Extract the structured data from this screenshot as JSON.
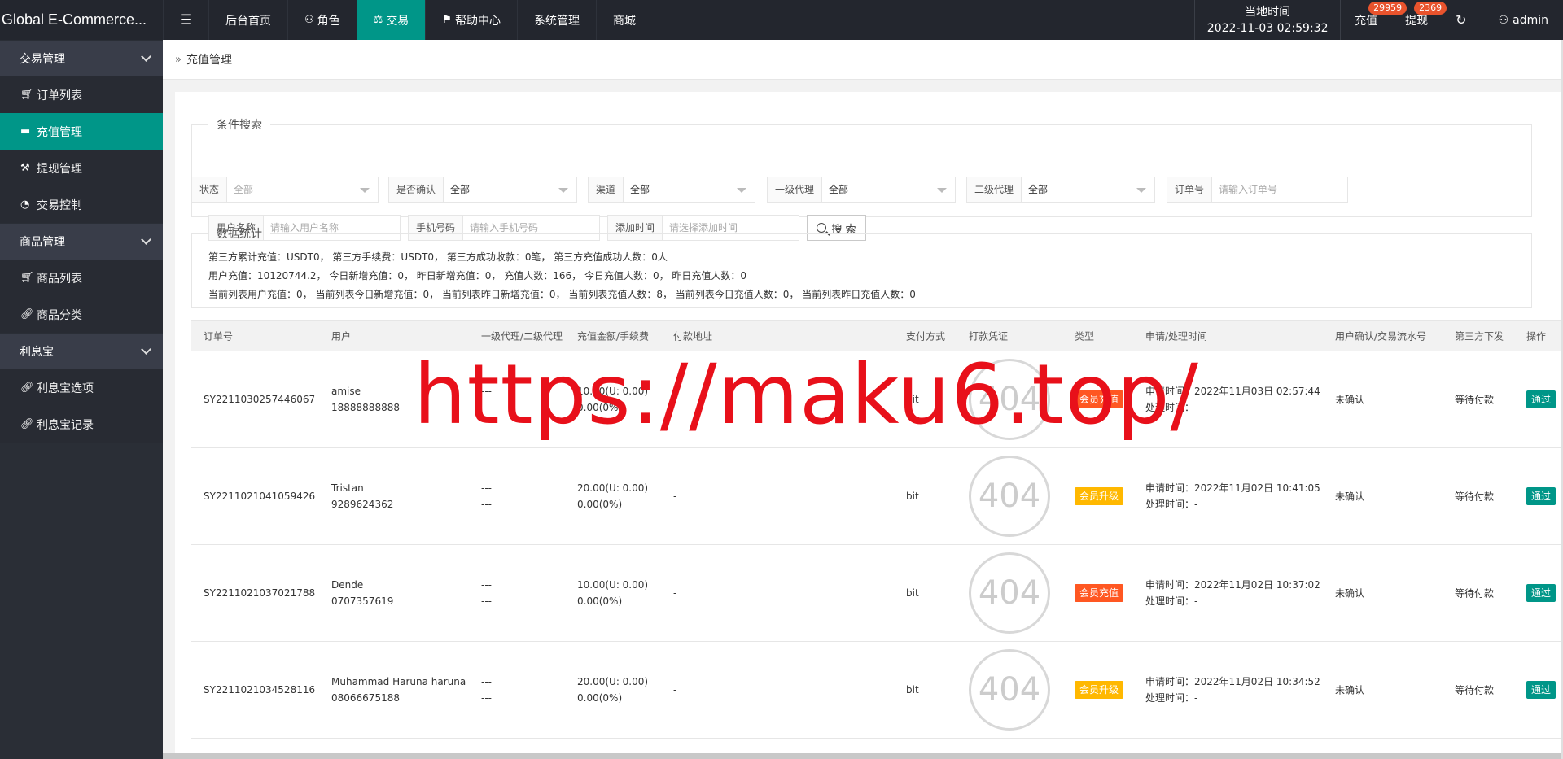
{
  "header": {
    "brand": "Global E-Commerce...",
    "menu_icon": "hamburger-icon",
    "nav": [
      {
        "label": "后台首页",
        "icon": ""
      },
      {
        "label": "角色",
        "icon": "user-icon"
      },
      {
        "label": "交易",
        "icon": "scale-icon"
      },
      {
        "label": "帮助中心",
        "icon": "flag-icon"
      },
      {
        "label": "系统管理",
        "icon": ""
      },
      {
        "label": "商城",
        "icon": ""
      }
    ],
    "clock_label": "当地时间",
    "clock_value": "2022-11-03 02:59:32",
    "recharge_label": "充值",
    "recharge_badge": "29959",
    "withdraw_label": "提现",
    "withdraw_badge": "2369",
    "user": "admin",
    "accent_color": "#009688"
  },
  "sidebar": {
    "groups": [
      {
        "label": "交易管理",
        "items": [
          {
            "label": "订单列表",
            "icon": "cart-icon"
          },
          {
            "label": "充值管理",
            "icon": "card-icon"
          },
          {
            "label": "提现管理",
            "icon": "gavel-icon"
          },
          {
            "label": "交易控制",
            "icon": "gauge-icon"
          }
        ]
      },
      {
        "label": "商品管理",
        "items": [
          {
            "label": "商品列表",
            "icon": "cart-icon"
          },
          {
            "label": "商品分类",
            "icon": "link-icon"
          }
        ]
      },
      {
        "label": "利息宝",
        "items": [
          {
            "label": "利息宝选项",
            "icon": "link-icon"
          },
          {
            "label": "利息宝记录",
            "icon": "link-icon"
          }
        ]
      }
    ]
  },
  "breadcrumb": "充值管理",
  "search": {
    "legend": "条件搜索",
    "status_label": "状态",
    "status_value": "全部",
    "confirm_label": "是否确认",
    "confirm_value": "全部",
    "channel_label": "渠道",
    "channel_value": "全部",
    "agent1_label": "一级代理",
    "agent1_value": "全部",
    "agent2_label": "二级代理",
    "agent2_value": "全部",
    "order_label": "订单号",
    "order_placeholder": "请输入订单号",
    "username_label": "用户名称",
    "username_placeholder": "请输入用户名称",
    "phone_label": "手机号码",
    "phone_placeholder": "请输入手机号码",
    "time_label": "添加时间",
    "time_placeholder": "请选择添加时间",
    "button": "搜 索"
  },
  "stats": {
    "legend": "数据统计",
    "line1": "第三方累计充值：USDT0，  第三方手续费：USDT0，  第三方成功收款：0笔，  第三方充值成功人数：0人",
    "line2": "用户充值：10120744.2，  今日新增充值：0，  昨日新增充值：0，  充值人数：166，  今日充值人数：0，  昨日充值人数：0",
    "line3": "当前列表用户充值：0，  当前列表今日新增充值：0，  当前列表昨日新增充值：0，  当前列表充值人数：8，  当前列表今日充值人数：0，  当前列表昨日充值人数：0"
  },
  "table": {
    "columns": [
      "订单号",
      "用户",
      "一级代理/二级代理",
      "充值金额/手续费",
      "付款地址",
      "支付方式",
      "打款凭证",
      "类型",
      "申请/处理时间",
      "用户确认/交易流水号",
      "第三方下发",
      "操作"
    ],
    "rows": [
      {
        "order": "SY2211030257446067",
        "user_name": "amise",
        "user_phone": "18888888888",
        "agent1": "---",
        "agent2": "---",
        "amount": "10.00(U: 0.00)",
        "fee": "0.00(0%)",
        "address": "-",
        "pay": "bit",
        "proof": "404",
        "type": "会员充值",
        "type_color": "#ff5722",
        "apply": "申请时间：2022年11月03日 02:57:44",
        "handle": "处理时间：-",
        "confirm": "未确认",
        "third": "等待付款",
        "action": "通过"
      },
      {
        "order": "SY2211021041059426",
        "user_name": "Tristan",
        "user_phone": "9289624362",
        "agent1": "---",
        "agent2": "---",
        "amount": "20.00(U: 0.00)",
        "fee": "0.00(0%)",
        "address": "-",
        "pay": "bit",
        "proof": "404",
        "type": "会员升级",
        "type_color": "#ffb800",
        "apply": "申请时间：2022年11月02日 10:41:05",
        "handle": "处理时间：-",
        "confirm": "未确认",
        "third": "等待付款",
        "action": "通过"
      },
      {
        "order": "SY2211021037021788",
        "user_name": "Dende",
        "user_phone": "0707357619",
        "agent1": "---",
        "agent2": "---",
        "amount": "10.00(U: 0.00)",
        "fee": "0.00(0%)",
        "address": "-",
        "pay": "bit",
        "proof": "404",
        "type": "会员充值",
        "type_color": "#ff5722",
        "apply": "申请时间：2022年11月02日 10:37:02",
        "handle": "处理时间：-",
        "confirm": "未确认",
        "third": "等待付款",
        "action": "通过"
      },
      {
        "order": "SY2211021034528116",
        "user_name": "Muhammad Haruna haruna",
        "user_phone": "08066675188",
        "agent1": "---",
        "agent2": "---",
        "amount": "20.00(U: 0.00)",
        "fee": "0.00(0%)",
        "address": "-",
        "pay": "bit",
        "proof": "404",
        "type": "会员升级",
        "type_color": "#ffb800",
        "apply": "申请时间：2022年11月02日 10:34:52",
        "handle": "处理时间：-",
        "confirm": "未确认",
        "third": "等待付款",
        "action": "通过"
      }
    ]
  },
  "watermark": "https://maku6.top/"
}
